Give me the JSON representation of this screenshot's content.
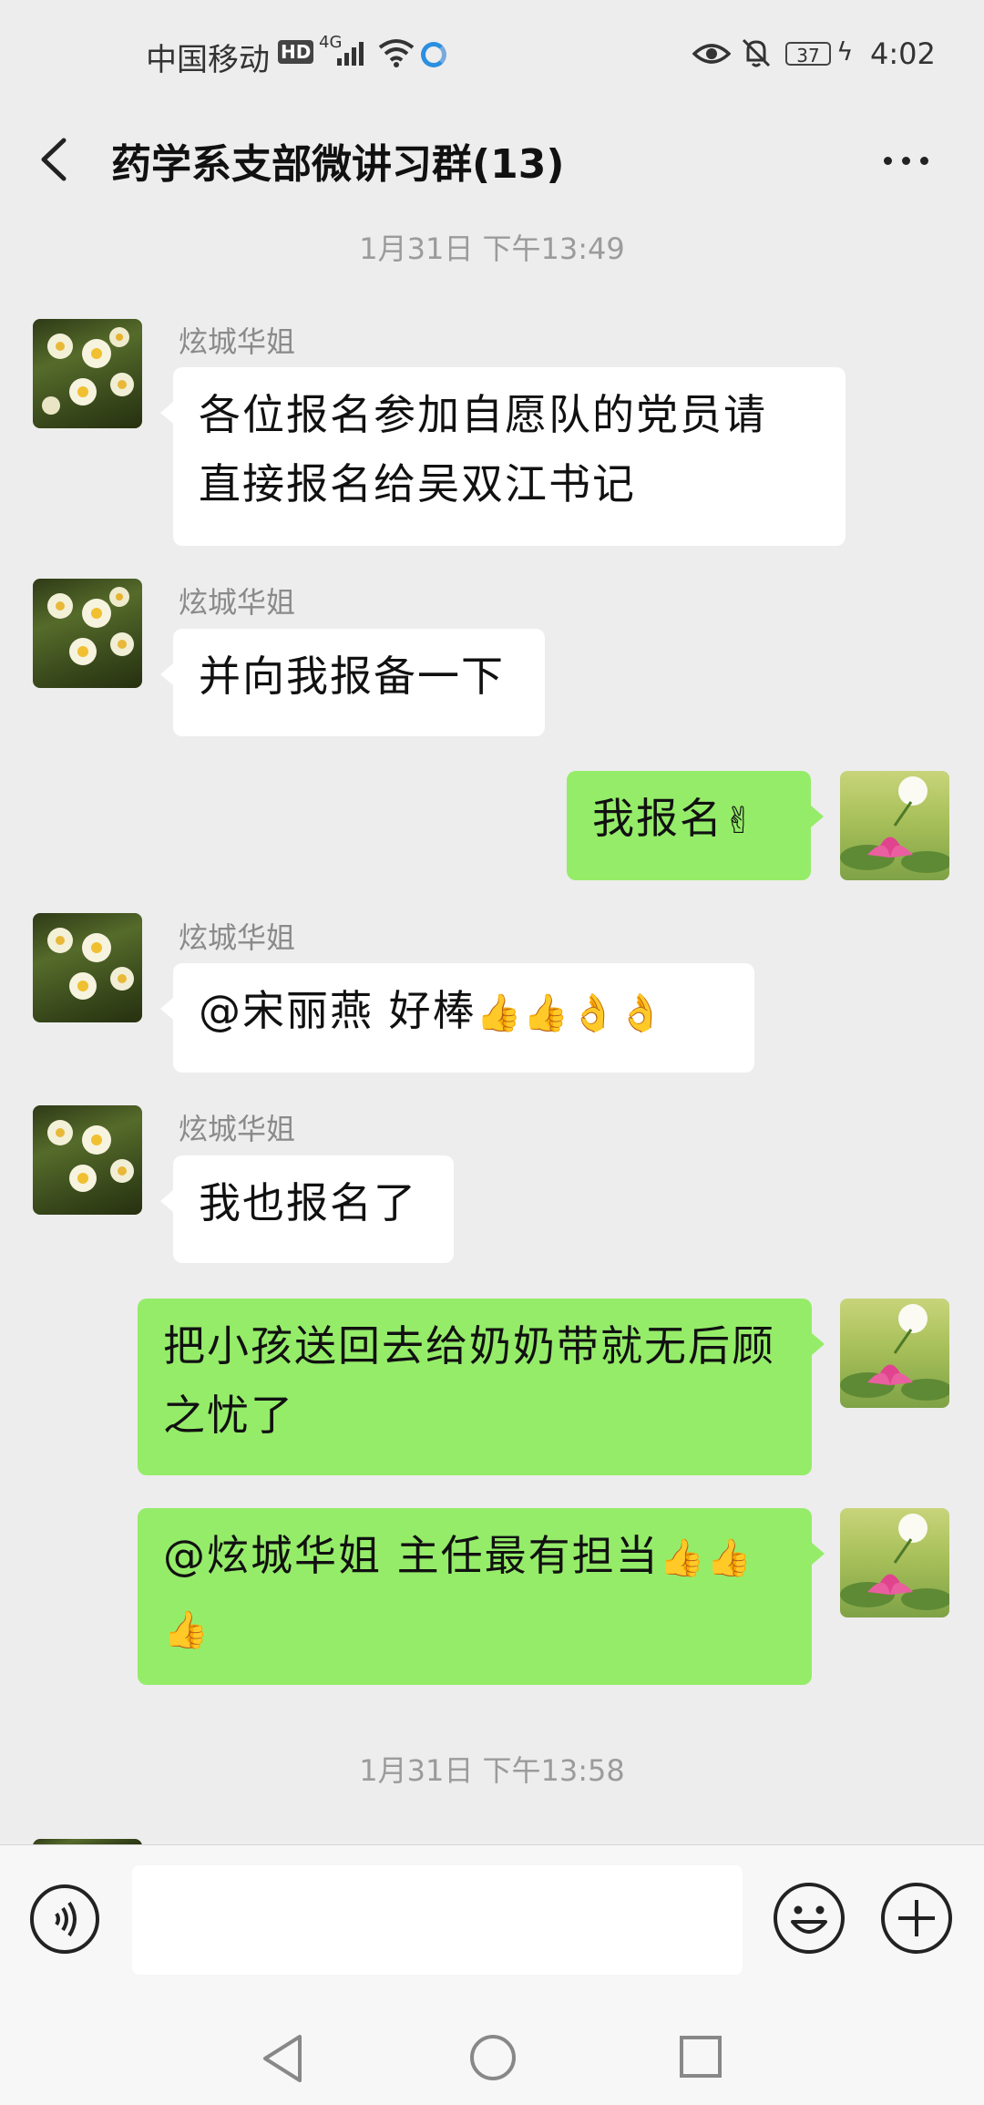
{
  "status_bar": {
    "carrier": "中国移动",
    "hd": "HD",
    "network": "4G",
    "battery": "37",
    "time": "4:02"
  },
  "header": {
    "title": "药学系支部微讲习群(13)"
  },
  "timestamps": [
    "1月31日 下午13:49",
    "1月31日 下午13:58"
  ],
  "messages": [
    {
      "side": "left",
      "sender": "炫城华姐",
      "lines": [
        "各位报名参加自愿队的党员请",
        "直接报名给吴双江书记"
      ]
    },
    {
      "side": "left",
      "sender": "炫城华姐",
      "text": "并向我报备一下"
    },
    {
      "side": "right",
      "text": "我报名",
      "emoji": "✌"
    },
    {
      "side": "left",
      "sender": "炫城华姐",
      "text": "@宋丽燕  好棒",
      "emoji": "👍👍👌👌"
    },
    {
      "side": "left",
      "sender": "炫城华姐",
      "text": "我也报名了"
    },
    {
      "side": "right",
      "lines": [
        "把小孩送回去给奶奶带就无后顾",
        "之忧了"
      ]
    },
    {
      "side": "right",
      "text": "@炫城华姐  主任最有担当",
      "emoji": "👍👍",
      "line2_emoji": "👍"
    }
  ],
  "avatars": {
    "others": "narcissus-flowers",
    "self": "white-pink-lotus"
  },
  "colors": {
    "background": "#ededed",
    "bubble_self": "#95ec69",
    "bubble_other": "#ffffff"
  },
  "icons": [
    "back-arrow-icon",
    "more-dots-icon",
    "voice-icon",
    "emoji-smile-icon",
    "plus-icon",
    "nav-back-icon",
    "nav-home-icon",
    "nav-recent-icon"
  ]
}
